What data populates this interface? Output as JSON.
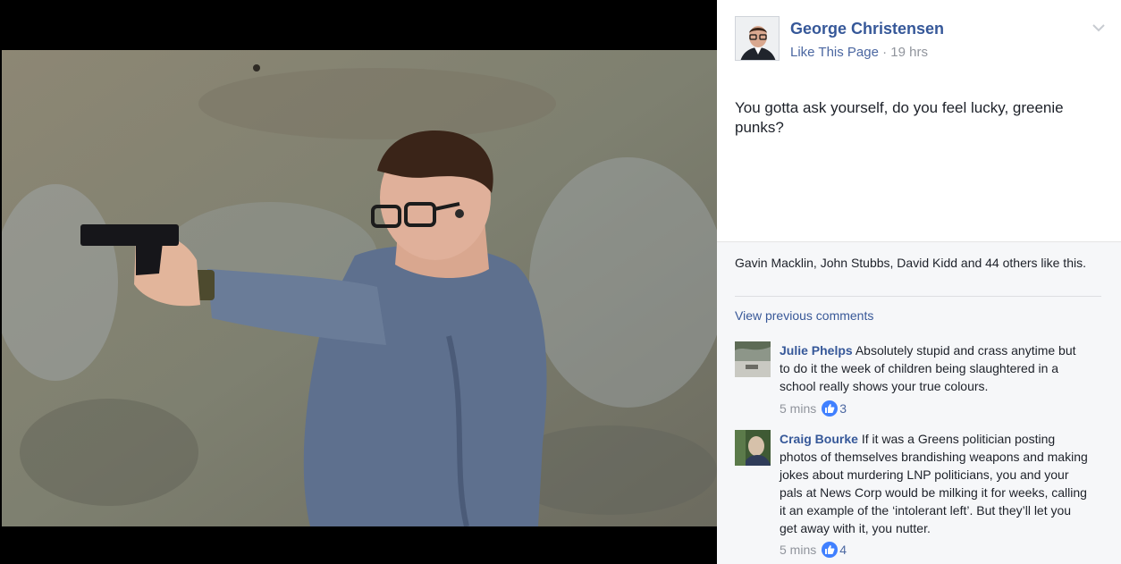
{
  "post": {
    "author": "George Christensen",
    "like_page": "Like This Page",
    "separator": "·",
    "time": "19 hrs",
    "text": "You gotta ask yourself, do you feel lucky, greenie punks?"
  },
  "feedback": {
    "likes_summary": "Gavin Macklin, John Stubbs, David Kidd and 44 others like this.",
    "view_previous": "View previous comments",
    "comments": [
      {
        "author": "Julie Phelps",
        "text": "Absolutely stupid and crass anytime but to do it the week of children being slaughtered in a school really shows your true colours.",
        "time": "5 mins",
        "likes": "3"
      },
      {
        "author": "Craig Bourke",
        "text": "If it was a Greens politician posting photos of themselves brandishing weapons and making jokes about murdering LNP politicians, you and your pals at News Corp would be milking it for weeks, calling it an example of the ‘intolerant left’. But they’ll let you get away with it, you nutter.",
        "time": "5 mins",
        "likes": "4"
      }
    ]
  },
  "colors": {
    "link": "#365899",
    "like_badge": "#4080ff",
    "panel_bg": "#f6f7f9"
  },
  "icons": {
    "menu": "chevron-down-icon",
    "like": "thumbs-up-icon"
  }
}
